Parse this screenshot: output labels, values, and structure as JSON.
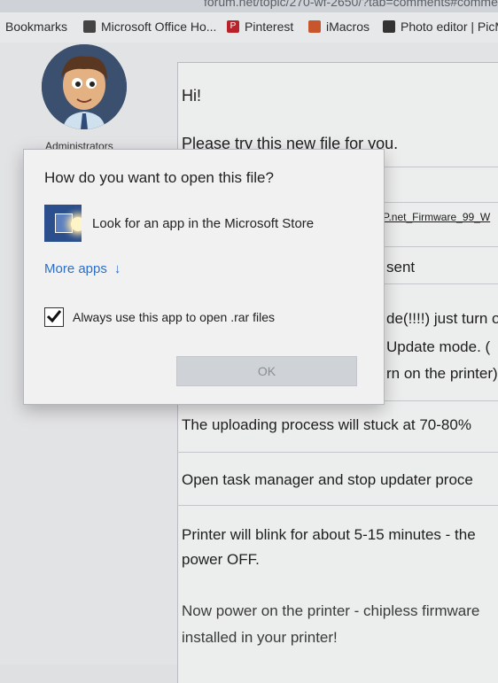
{
  "browser": {
    "url_fragment": "forum.net/topic/270-wf-2650/?tab=comments#comme",
    "bookmarks": [
      {
        "label": "Bookmarks",
        "icon": "bookmarks-icon"
      },
      {
        "label": "Microsoft Office Ho...",
        "icon": "office-icon"
      },
      {
        "label": "Pinterest",
        "icon": "pinterest-icon"
      },
      {
        "label": "iMacros",
        "icon": "imacros-icon"
      },
      {
        "label": "Photo editor | PicM...",
        "icon": "photo-editor-icon"
      }
    ]
  },
  "post": {
    "author_role": "Administrators",
    "lines": [
      "Hi!",
      "Please try this new file for you.",
      "P.net_Firmware_99_W",
      "sent",
      "de(!!!!) just turn o",
      "Update mode. (",
      "rn on the printer)",
      "The uploading process will stuck at 70-80%",
      "Open task manager and stop updater proce",
      "Printer will blink for about 5-15 minutes - the",
      "power OFF.",
      "Now power on the printer - chipless firmware",
      "installed in your printer!"
    ]
  },
  "dialog": {
    "title": "How do you want to open this file?",
    "store_option": "Look for an app in the Microsoft Store",
    "more_apps": "More apps",
    "more_apps_arrow": "↓",
    "always_use": "Always use this app to open .rar files",
    "always_use_checked": true,
    "ok": "OK"
  },
  "colors": {
    "link_blue": "#2a6fc9",
    "store_blue": "#2b4e8c"
  }
}
